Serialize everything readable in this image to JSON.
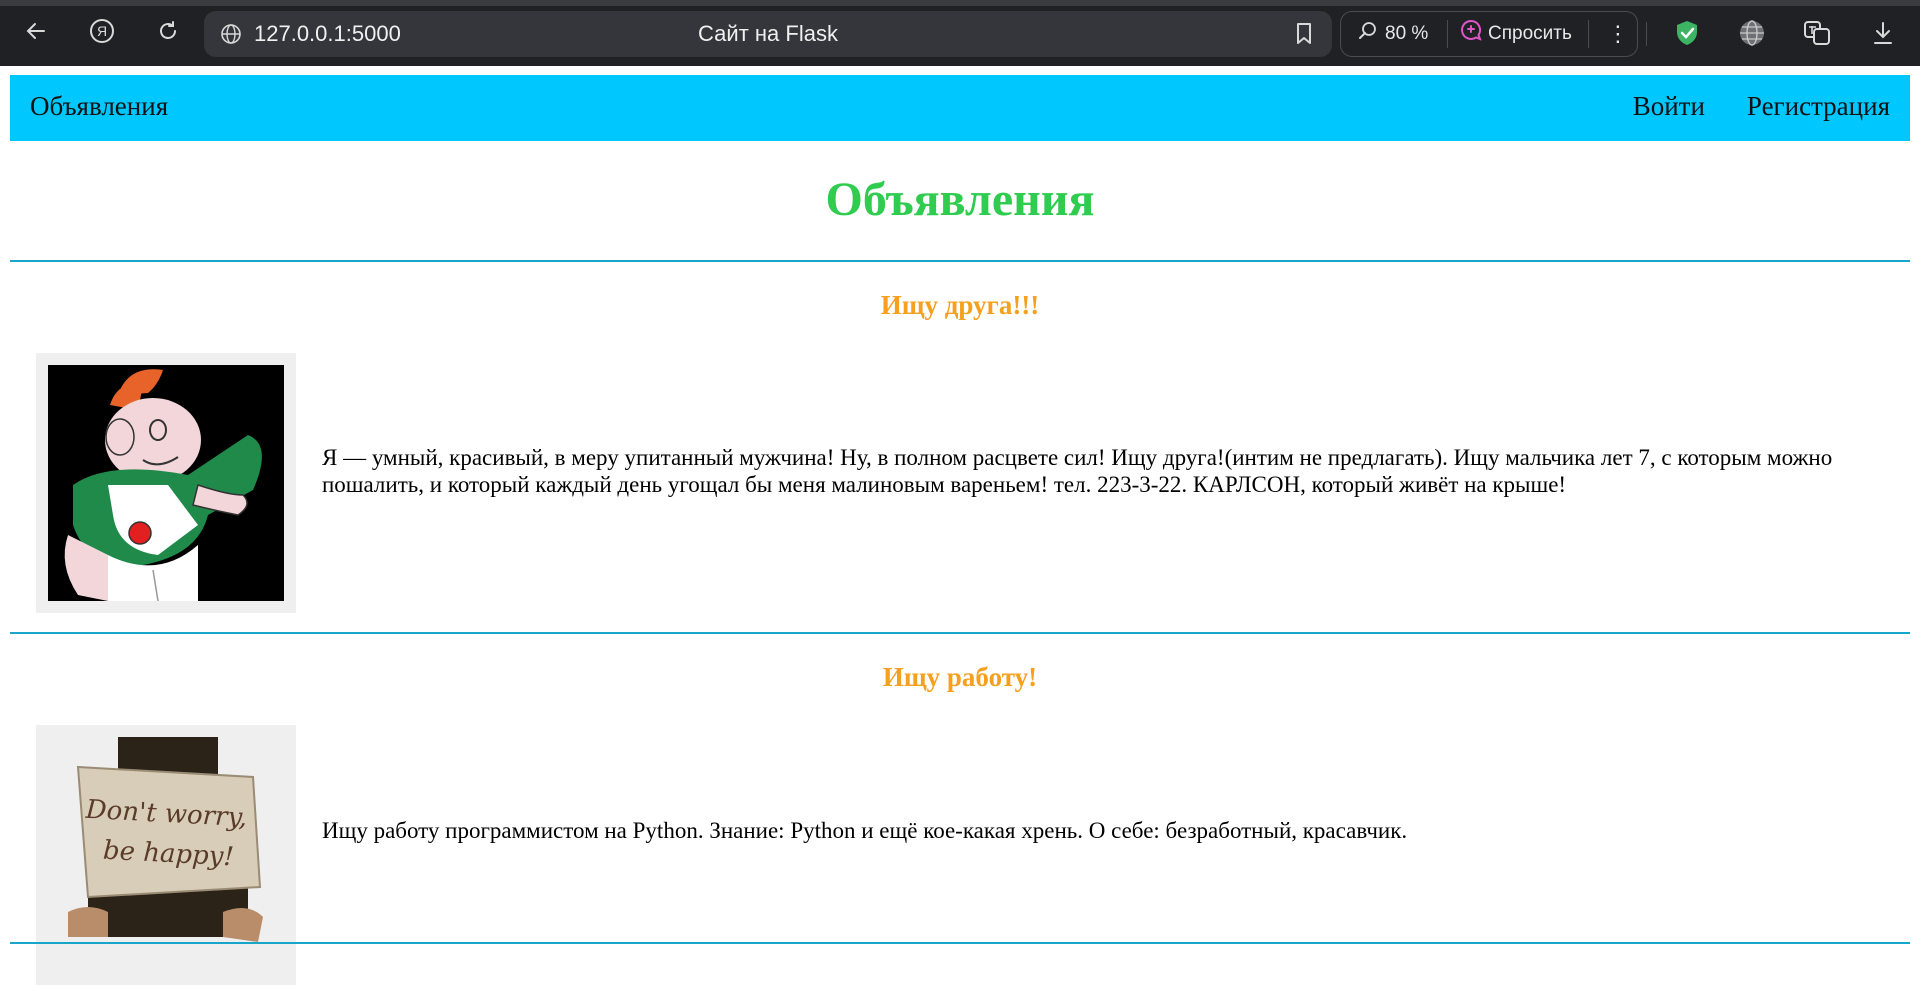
{
  "browser": {
    "url": "127.0.0.1:5000",
    "tab_title": "Сайт на Flask",
    "zoom": "80 %",
    "ask_label": "Спросить"
  },
  "navbar": {
    "brand": "Объявления",
    "links": [
      "Войти",
      "Регистрация"
    ]
  },
  "page": {
    "title": "Объявления",
    "ads": [
      {
        "title": "Ищу друга!!!",
        "text": "Я — умный, красивый, в меру упитанный мужчина! Ну, в полном расцвете сил! Ищу друга!(интим не предлагать). Ищу мальчика лет 7, с которым можно пошалить, и который каждый день угощал бы меня малиновым вареньем! тел. 223-3-22. КАРЛСОН, который живёт на крыше!"
      },
      {
        "title": "Ищу работу!",
        "text": "Ищу работу программистом на Python. Знание: Python и ещё кое-какая хрень. О себе: безработный, красавчик.",
        "sign_line1": "Don't worry,",
        "sign_line2": "be happy!"
      }
    ]
  },
  "colors": {
    "navbar_bg": "#00c8ff",
    "title": "#2fcc4f",
    "ad_title": "#f5a01e",
    "divider": "#17a6c9"
  },
  "icons": [
    "back-arrow-icon",
    "yandex-icon",
    "reload-icon",
    "globe-icon",
    "bookmark-icon",
    "search-zoom-icon",
    "ask-alice-icon",
    "more-vertical-icon",
    "shield-check-icon",
    "globe-extension-icon",
    "translate-icon",
    "download-icon"
  ]
}
